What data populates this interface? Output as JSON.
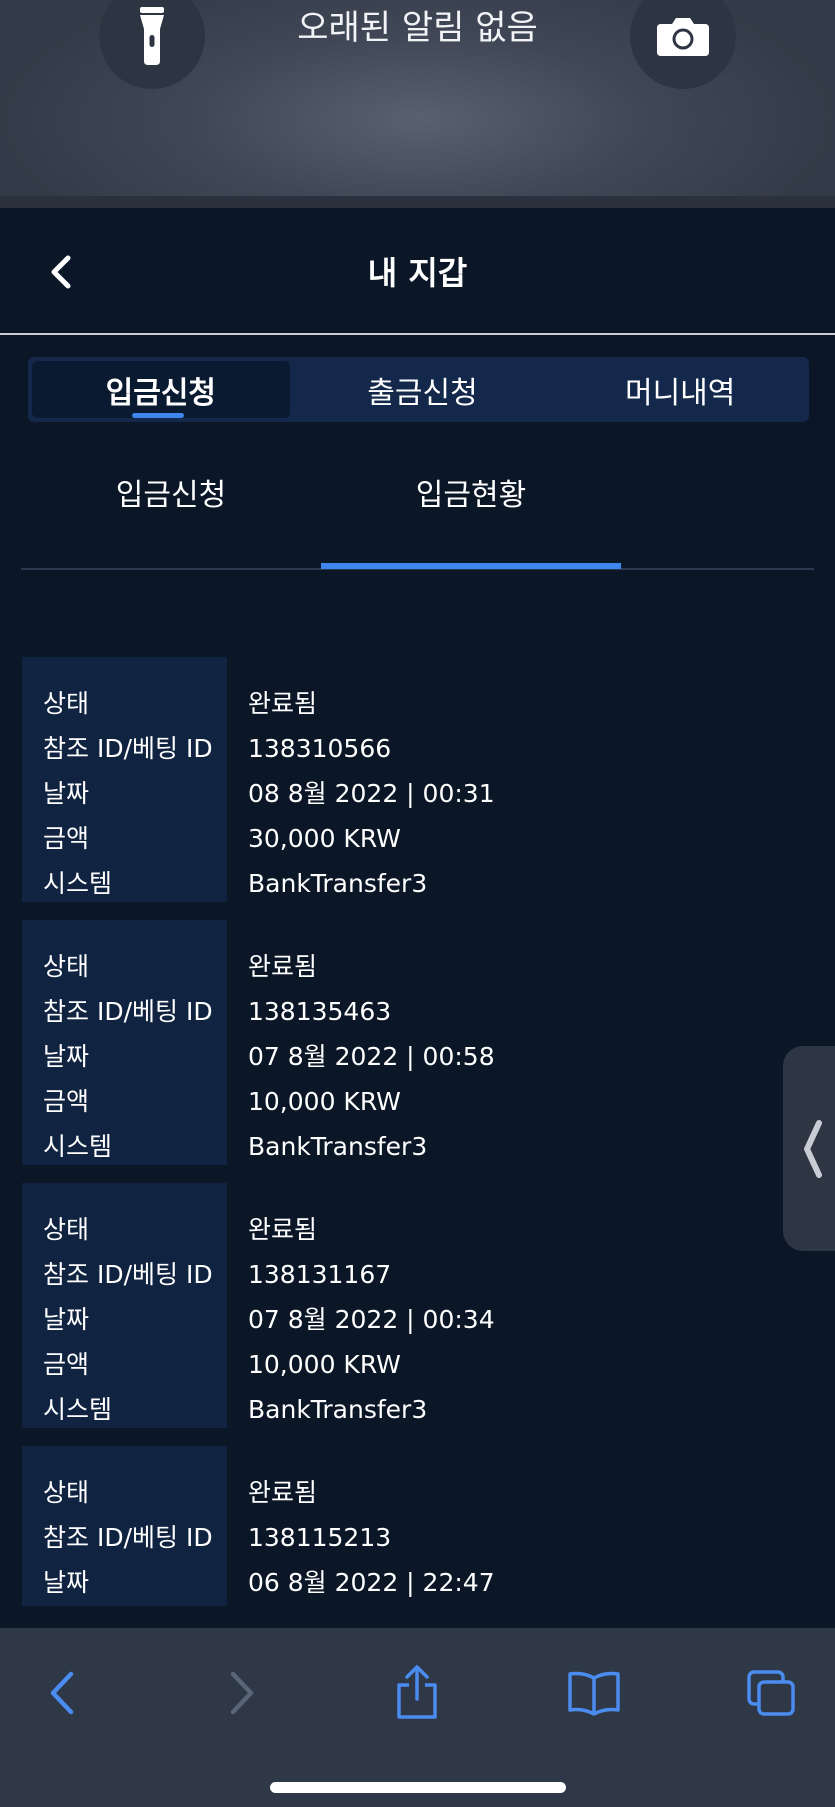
{
  "lock_screen": {
    "notification_text": "오래된 알림 없음",
    "flashlight_icon": "flashlight-icon",
    "camera_icon": "camera-icon"
  },
  "header": {
    "title": "내 지갑",
    "back_icon": "chevron-left-icon"
  },
  "main_tabs": [
    {
      "label": "입금신청",
      "active": true
    },
    {
      "label": "출금신청",
      "active": false
    },
    {
      "label": "머니내역",
      "active": false
    }
  ],
  "sub_tabs": [
    {
      "label": "입금신청",
      "active": false
    },
    {
      "label": "입금현황",
      "active": true
    }
  ],
  "record_labels": {
    "status": "상태",
    "ref_id": "참조 ID/베팅 ID",
    "date": "날짜",
    "amount": "금액",
    "system": "시스템"
  },
  "records": [
    {
      "status": "완료됨",
      "ref_id": "138310566",
      "date": "08 8월 2022 | 00:31",
      "amount": "30,000 KRW",
      "system": "BankTransfer3"
    },
    {
      "status": "완료됨",
      "ref_id": "138135463",
      "date": "07 8월 2022 | 00:58",
      "amount": "10,000 KRW",
      "system": "BankTransfer3"
    },
    {
      "status": "완료됨",
      "ref_id": "138131167",
      "date": "07 8월 2022 | 00:34",
      "amount": "10,000 KRW",
      "system": "BankTransfer3"
    },
    {
      "status": "완료됨",
      "ref_id": "138115213",
      "date": "06 8월 2022 | 22:47"
    }
  ],
  "colors": {
    "accent": "#3d86ee",
    "background": "#0b1627",
    "label_panel": "#102340",
    "toolbar_icon": "#4a8cf0"
  }
}
